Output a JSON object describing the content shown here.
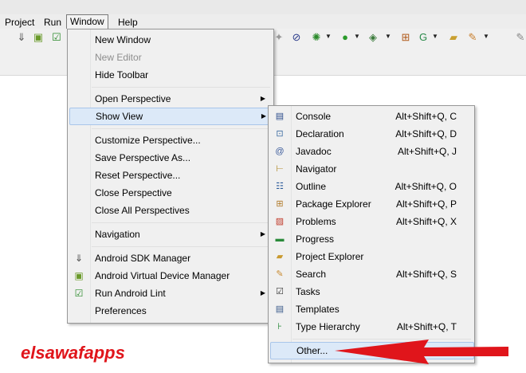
{
  "menubar": {
    "items": [
      "Project",
      "Run",
      "Window",
      "Help"
    ]
  },
  "window_menu": {
    "items": [
      {
        "label": "New Window"
      },
      {
        "label": "New Editor"
      },
      {
        "label": "Hide Toolbar"
      },
      {
        "label": "Open Perspective"
      },
      {
        "label": "Show View"
      },
      {
        "label": "Customize Perspective..."
      },
      {
        "label": "Save Perspective As..."
      },
      {
        "label": "Reset Perspective..."
      },
      {
        "label": "Close Perspective"
      },
      {
        "label": "Close All Perspectives"
      },
      {
        "label": "Navigation"
      },
      {
        "label": "Android SDK Manager"
      },
      {
        "label": "Android Virtual Device Manager"
      },
      {
        "label": "Run Android Lint"
      },
      {
        "label": "Preferences"
      }
    ]
  },
  "show_view_menu": {
    "items": [
      {
        "label": "Console",
        "shortcut": "Alt+Shift+Q, C"
      },
      {
        "label": "Declaration",
        "shortcut": "Alt+Shift+Q, D"
      },
      {
        "label": "Javadoc",
        "shortcut": "Alt+Shift+Q, J"
      },
      {
        "label": "Navigator",
        "shortcut": ""
      },
      {
        "label": "Outline",
        "shortcut": "Alt+Shift+Q, O"
      },
      {
        "label": "Package Explorer",
        "shortcut": "Alt+Shift+Q, P"
      },
      {
        "label": "Problems",
        "shortcut": "Alt+Shift+Q, X"
      },
      {
        "label": "Progress",
        "shortcut": ""
      },
      {
        "label": "Project Explorer",
        "shortcut": ""
      },
      {
        "label": "Search",
        "shortcut": "Alt+Shift+Q, S"
      },
      {
        "label": "Tasks",
        "shortcut": ""
      },
      {
        "label": "Templates",
        "shortcut": ""
      },
      {
        "label": "Type Hierarchy",
        "shortcut": "Alt+Shift+Q, T"
      },
      {
        "label": "Other...",
        "shortcut": ""
      }
    ]
  },
  "watermark": "elsawafapps",
  "colors": {
    "highlight": "#dce9f8",
    "watermark": "#e0151b",
    "menu_bg": "#f0f0f0"
  }
}
